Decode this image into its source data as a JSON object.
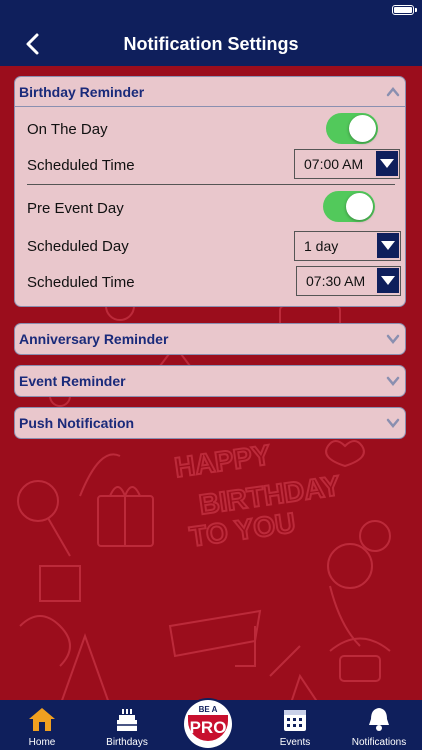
{
  "header": {
    "title": "Notification Settings"
  },
  "birthday": {
    "title": "Birthday Reminder",
    "on_day_label": "On The Day",
    "sched_time_label": "Scheduled Time",
    "sched_time_value": "07:00 AM",
    "pre_event_label": "Pre Event Day",
    "sched_day_label": "Scheduled Day",
    "sched_day_value": "1 day",
    "sched_time2_label": "Scheduled Time",
    "sched_time2_value": "07:30 AM"
  },
  "anniversary": {
    "title": "Anniversary Reminder"
  },
  "event": {
    "title": "Event Reminder"
  },
  "push": {
    "title": "Push Notification"
  },
  "tabs": {
    "home": "Home",
    "birthdays": "Birthdays",
    "pro_top": "BE A",
    "pro_main": "PRO",
    "events": "Events",
    "notifications": "Notifications"
  },
  "colors": {
    "nav": "#0f1f5c",
    "bg": "#9b0d1c",
    "toggle": "#52c95b",
    "panel": "#e9c7cc",
    "accent": "#f0a020"
  }
}
